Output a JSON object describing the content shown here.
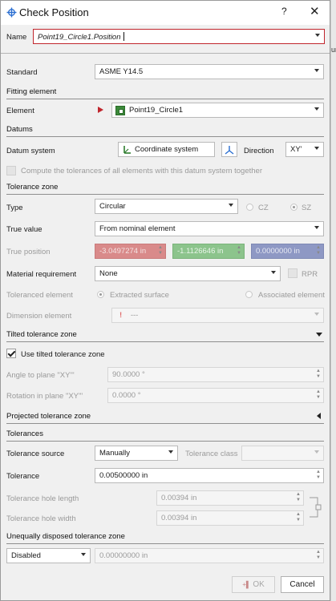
{
  "window": {
    "title": "Check Position",
    "help": "?",
    "close": "✕"
  },
  "right_strip": {
    "fragment": "ur"
  },
  "name": {
    "label": "Name",
    "value": "Point19_Circle1.Position"
  },
  "standard": {
    "label": "Standard",
    "value": "ASME Y14.5"
  },
  "fitting": {
    "section": "Fitting element",
    "element_label": "Element",
    "element_value": "Point19_Circle1"
  },
  "datums": {
    "section": "Datums",
    "system_label": "Datum system",
    "system_value": "Coordinate system",
    "direction_label": "Direction",
    "direction_value": "XY'",
    "compute_all": "Compute the tolerances of all elements with this datum system together"
  },
  "tolerance_zone": {
    "section": "Tolerance zone",
    "type_label": "Type",
    "type_value": "Circular",
    "cz": "CZ",
    "sz": "SZ",
    "true_value_label": "True value",
    "true_value_value": "From nominal element",
    "true_position_label": "True position",
    "true_position_x": "-3.0497274 in",
    "true_position_y": "-1.1126646 in",
    "true_position_z": "0.0000000 in",
    "material_label": "Material requirement",
    "material_value": "None",
    "rpr": "RPR",
    "toleranced_label": "Toleranced element",
    "extracted": "Extracted surface",
    "associated": "Associated element",
    "dimension_label": "Dimension element",
    "dimension_value": "---"
  },
  "tilted": {
    "section": "Tilted tolerance zone",
    "use_label": "Use tilted tolerance zone",
    "angle_label": "Angle to plane \"XY'\"",
    "angle_value": "90.0000 °",
    "rotation_label": "Rotation in plane \"XY'\"",
    "rotation_value": "0.0000 °"
  },
  "projected": {
    "section": "Projected tolerance zone"
  },
  "tolerances": {
    "section": "Tolerances",
    "source_label": "Tolerance source",
    "source_value": "Manually",
    "class_label": "Tolerance class",
    "tolerance_label": "Tolerance",
    "tolerance_value": "0.00500000 in",
    "hole_length_label": "Tolerance hole length",
    "hole_length_value": "0.00394 in",
    "hole_width_label": "Tolerance hole width",
    "hole_width_value": "0.00394 in"
  },
  "unequal": {
    "section": "Unequally disposed tolerance zone",
    "mode_value": "Disabled",
    "offset_value": "0.00000000 in"
  },
  "footer": {
    "ok": "OK",
    "cancel": "Cancel"
  },
  "colors": {
    "accent_red": "#c0262d",
    "x_field": "#d98a8a",
    "y_field": "#8cc48c",
    "z_field": "#8e98c4",
    "icon_blue": "#2b6fd1"
  }
}
